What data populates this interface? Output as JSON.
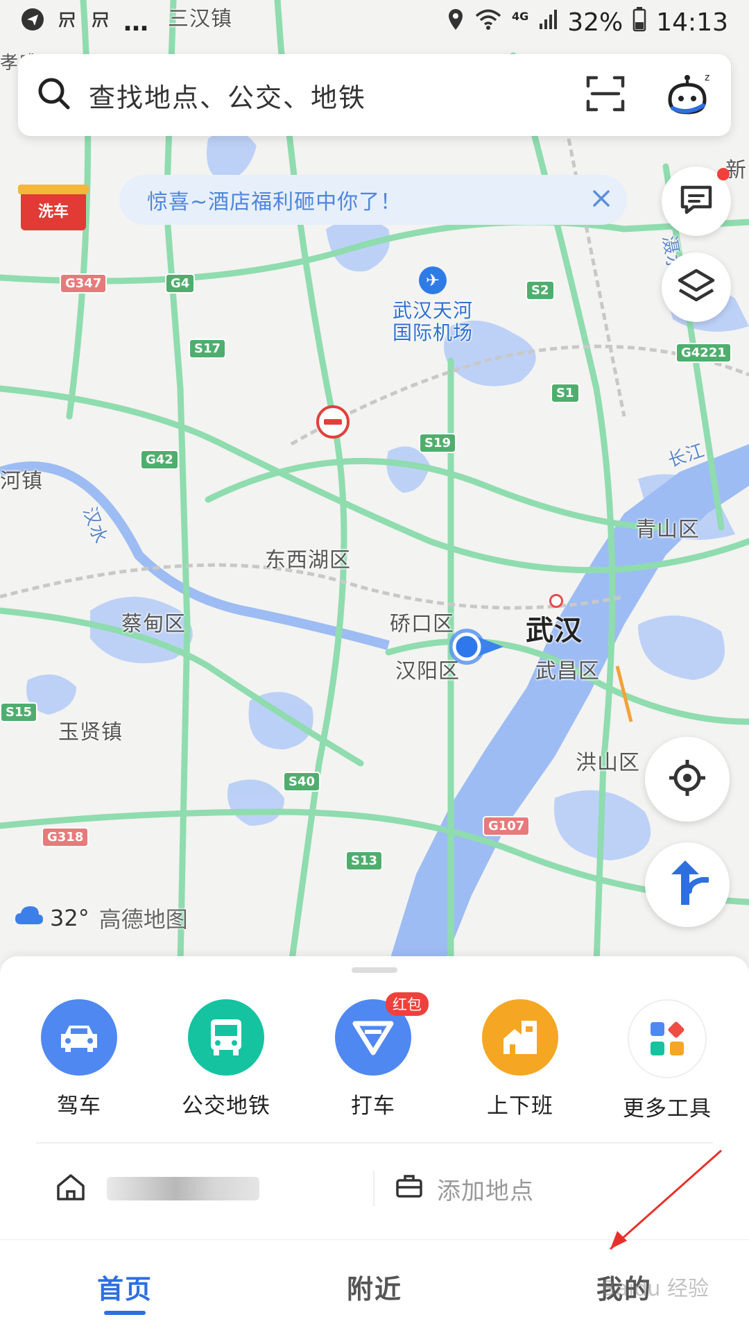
{
  "status_bar": {
    "left_ellipsis": "…",
    "top_place": "三汉镇",
    "battery": "32%",
    "time": "14:13",
    "network": "4G"
  },
  "search": {
    "placeholder": "查找地点、公交、地铁",
    "icons": [
      "search-icon",
      "scan-icon",
      "assistant-bot-icon"
    ]
  },
  "promo": {
    "text": "惊喜~酒店福利砸中你了！",
    "wash_badge": "洗车"
  },
  "map_labels": {
    "airport": "武汉天河国际机场",
    "city": "武汉",
    "districts": [
      "东西湖区",
      "蔡甸区",
      "硚口区",
      "汉阳区",
      "武昌区",
      "青山区",
      "洪山区"
    ],
    "towns": [
      "玉贤镇",
      "河镇",
      "孝感"
    ],
    "rivers": [
      "汉水",
      "长江",
      "滠水"
    ],
    "top_right_fragment": "新"
  },
  "road_shields": {
    "green": [
      "G4",
      "S17",
      "S2",
      "S1",
      "S19",
      "G42",
      "S40",
      "S13",
      "G4221",
      "S15"
    ],
    "red": [
      "G347",
      "G318",
      "G107"
    ]
  },
  "weather": {
    "temperature": "32°",
    "logo_text": "高德地图"
  },
  "tools": [
    {
      "label": "驾车",
      "color": "#4f88f1",
      "icon": "car-icon"
    },
    {
      "label": "公交地铁",
      "color": "#15c3a0",
      "icon": "bus-icon"
    },
    {
      "label": "打车",
      "color": "#4f88f1",
      "icon": "taxi-icon",
      "badge": "红包"
    },
    {
      "label": "上下班",
      "color": "#f5a623",
      "icon": "commute-icon"
    },
    {
      "label": "更多工具",
      "color": "#ffffff",
      "icon": "more-tools-icon"
    }
  ],
  "places": {
    "add_label": "添加地点"
  },
  "tabs": [
    {
      "label": "首页",
      "active": true
    },
    {
      "label": "附近",
      "active": false
    },
    {
      "label": "我的",
      "active": false
    }
  ],
  "watermark": "Baidu 经验",
  "colors": {
    "accent": "#2e6fe0",
    "road_green": "#8fdcaf",
    "water": "#b7cdf6",
    "river": "#9dbcf3"
  }
}
